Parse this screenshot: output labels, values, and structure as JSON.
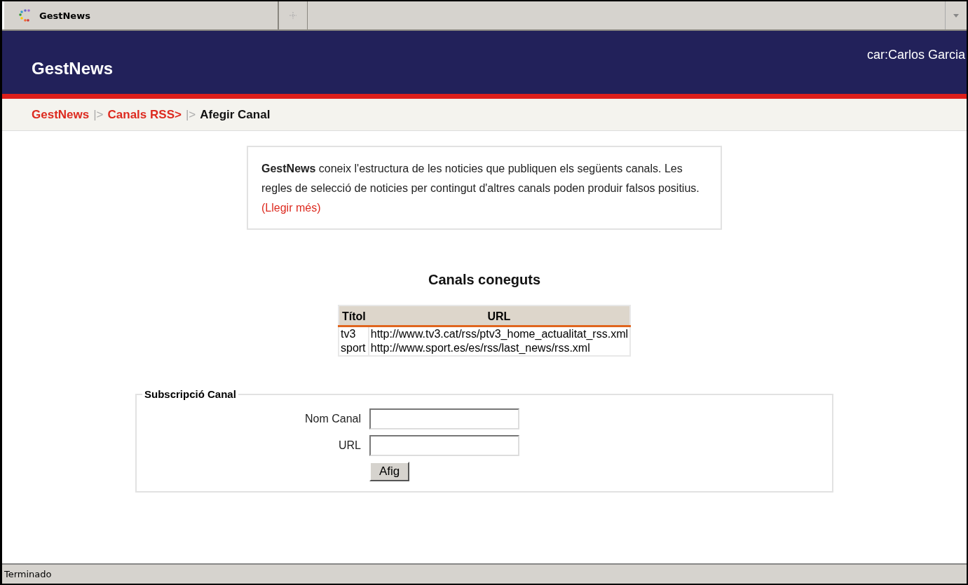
{
  "browser": {
    "tabs": [
      {
        "label": "GestNews",
        "selected": true
      }
    ]
  },
  "header": {
    "title": "GestNews",
    "user": "car:Carlos Garcia"
  },
  "breadcrumb": [
    {
      "kind": "link",
      "text": "GestNews"
    },
    {
      "kind": "separator",
      "text": "|>"
    },
    {
      "kind": "link",
      "text": "Canals RSS>"
    },
    {
      "kind": "separator",
      "text": "|>"
    },
    {
      "kind": "current",
      "text": "Afegir Canal"
    }
  ],
  "notice": {
    "text": "**GestNews** coneix l'estructura de les noticies que publiquen els següents canals. Les regles de selecció de noticies per contingut d'altres canals poden produir falsos positius.",
    "link": "(Llegir més)"
  },
  "known_channels": {
    "title": "Canals coneguts",
    "columns": [
      "Títol",
      "URL"
    ],
    "rows": [
      [
        "tv3",
        "http://www.tv3.cat/rss/ptv3_home_actualitat_rss.xml"
      ],
      [
        "sport",
        "http://www.sport.es/es/rss/last_news/rss.xml"
      ]
    ]
  },
  "subscription": {
    "legend": "Subscripció Canal",
    "fields": [
      {
        "label": "Nom Canal"
      },
      {
        "label": "URL"
      }
    ],
    "button": "Afig"
  },
  "status_bar": {
    "text": "Terminado"
  }
}
